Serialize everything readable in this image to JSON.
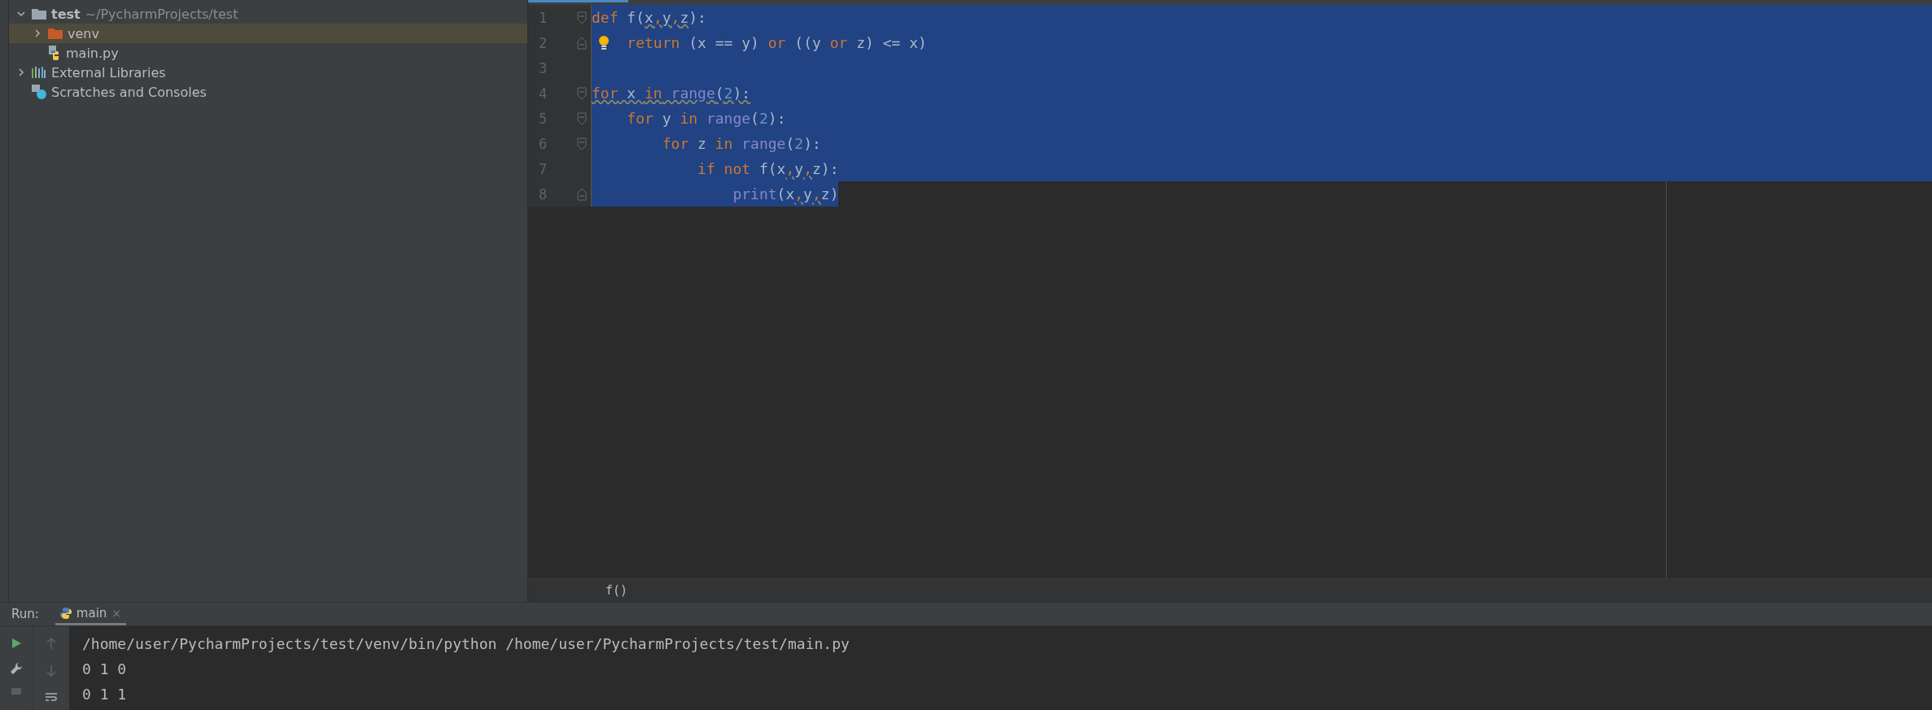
{
  "project_tree": [
    {
      "label": "test",
      "path": "~/PycharmProjects/test",
      "kind": "folder",
      "expanded": true,
      "selected": false,
      "children": [
        {
          "label": "venv",
          "kind": "venv",
          "expanded": false,
          "selected": true
        },
        {
          "label": "main.py",
          "kind": "python",
          "selected": false
        }
      ]
    },
    {
      "label": "External Libraries",
      "kind": "library",
      "expanded": false,
      "selected": false
    },
    {
      "label": "Scratches and Consoles",
      "kind": "scratch",
      "selected": false
    }
  ],
  "editor": {
    "lines": [
      {
        "number": "1",
        "fold_start": true,
        "fold_end": false,
        "bulb": false,
        "selected": true,
        "selected_full_width": true,
        "tokens": [
          {
            "text": "def",
            "color": "#cc7832",
            "underlined": false
          },
          {
            "text": " f(",
            "color": "#a9b7c6",
            "underlined": false
          },
          {
            "text": "x",
            "color": "#a9b7c6",
            "underlined": true
          },
          {
            "text": ",",
            "color": "#cc7832",
            "underlined": true
          },
          {
            "text": "y",
            "color": "#a9b7c6",
            "underlined": true
          },
          {
            "text": ",",
            "color": "#cc7832",
            "underlined": true
          },
          {
            "text": "z",
            "color": "#a9b7c6",
            "underlined": true
          },
          {
            "text": "):",
            "color": "#a9b7c6",
            "underlined": false
          }
        ]
      },
      {
        "number": "2",
        "fold_start": false,
        "fold_end": true,
        "bulb": true,
        "selected": true,
        "selected_full_width": true,
        "tokens": [
          {
            "text": "    return",
            "color": "#cc7832",
            "underlined": false
          },
          {
            "text": " (x == y) ",
            "color": "#a9b7c6",
            "underlined": false
          },
          {
            "text": "or",
            "color": "#cc7832",
            "underlined": false
          },
          {
            "text": " ((y ",
            "color": "#a9b7c6",
            "underlined": false
          },
          {
            "text": "or",
            "color": "#cc7832",
            "underlined": false
          },
          {
            "text": " z) <= x)",
            "color": "#a9b7c6",
            "underlined": false
          }
        ]
      },
      {
        "number": "3",
        "fold_start": false,
        "fold_end": false,
        "bulb": false,
        "selected": true,
        "selected_full_width": true
      },
      {
        "number": "4",
        "fold_start": true,
        "fold_end": false,
        "bulb": false,
        "selected": true,
        "selected_full_width": true,
        "tokens": [
          {
            "text": "for",
            "color": "#cc7832",
            "underlined": true
          },
          {
            "text": " x ",
            "color": "#a9b7c6",
            "underlined": true
          },
          {
            "text": "in",
            "color": "#cc7832",
            "underlined": true
          },
          {
            "text": " range",
            "color": "#8888c6",
            "underlined": true
          },
          {
            "text": "(",
            "color": "#a9b7c6",
            "underlined": true
          },
          {
            "text": "2",
            "color": "#6897bb",
            "underlined": true
          },
          {
            "text": "):",
            "color": "#a9b7c6",
            "underlined": true
          }
        ]
      },
      {
        "number": "5",
        "fold_start": true,
        "fold_end": false,
        "bulb": false,
        "selected": true,
        "selected_full_width": true,
        "tokens": [
          {
            "text": "    for",
            "color": "#cc7832",
            "underlined": false
          },
          {
            "text": " y ",
            "color": "#a9b7c6",
            "underlined": false
          },
          {
            "text": "in",
            "color": "#cc7832",
            "underlined": false
          },
          {
            "text": " range",
            "color": "#8888c6",
            "underlined": false
          },
          {
            "text": "(",
            "color": "#a9b7c6",
            "underlined": false
          },
          {
            "text": "2",
            "color": "#6897bb",
            "underlined": false
          },
          {
            "text": "):",
            "color": "#a9b7c6",
            "underlined": false
          }
        ]
      },
      {
        "number": "6",
        "fold_start": true,
        "fold_end": false,
        "bulb": false,
        "selected": true,
        "selected_full_width": true,
        "tokens": [
          {
            "text": "        for",
            "color": "#cc7832",
            "underlined": false
          },
          {
            "text": " z ",
            "color": "#a9b7c6",
            "underlined": false
          },
          {
            "text": "in",
            "color": "#cc7832",
            "underlined": false
          },
          {
            "text": " range",
            "color": "#8888c6",
            "underlined": false
          },
          {
            "text": "(",
            "color": "#a9b7c6",
            "underlined": false
          },
          {
            "text": "2",
            "color": "#6897bb",
            "underlined": false
          },
          {
            "text": "):",
            "color": "#a9b7c6",
            "underlined": false
          }
        ]
      },
      {
        "number": "7",
        "fold_start": false,
        "fold_end": false,
        "bulb": false,
        "selected": true,
        "selected_full_width": true,
        "tokens": [
          {
            "text": "            if",
            "color": "#cc7832",
            "underlined": false
          },
          {
            "text": " not",
            "color": "#cc7832",
            "underlined": false
          },
          {
            "text": " f(x",
            "color": "#a9b7c6",
            "underlined": false
          },
          {
            "text": ",",
            "color": "#cc7832",
            "underlined": true
          },
          {
            "text": "y",
            "color": "#a9b7c6",
            "underlined": false
          },
          {
            "text": ",",
            "color": "#cc7832",
            "underlined": true
          },
          {
            "text": "z):",
            "color": "#a9b7c6",
            "underlined": false
          }
        ]
      },
      {
        "number": "8",
        "fold_start": false,
        "fold_end": true,
        "bulb": false,
        "selected": true,
        "selected_full_width": false,
        "tokens": [
          {
            "text": "                print",
            "color": "#8888c6",
            "underlined": false
          },
          {
            "text": "(x",
            "color": "#a9b7c6",
            "underlined": false
          },
          {
            "text": ",",
            "color": "#cc7832",
            "underlined": true
          },
          {
            "text": "y",
            "color": "#a9b7c6",
            "underlined": false
          },
          {
            "text": ",",
            "color": "#cc7832",
            "underlined": true
          },
          {
            "text": "z)",
            "color": "#a9b7c6",
            "underlined": false
          }
        ]
      }
    ],
    "breadcrumb": "f()"
  },
  "run_panel": {
    "label": "Run:",
    "tabs": [
      {
        "label": "main",
        "selected": true,
        "close": "×"
      }
    ],
    "output": [
      "/home/user/PycharmProjects/test/venv/bin/python /home/user/PycharmProjects/test/main.py",
      "0 1 0",
      "0 1 1"
    ]
  }
}
